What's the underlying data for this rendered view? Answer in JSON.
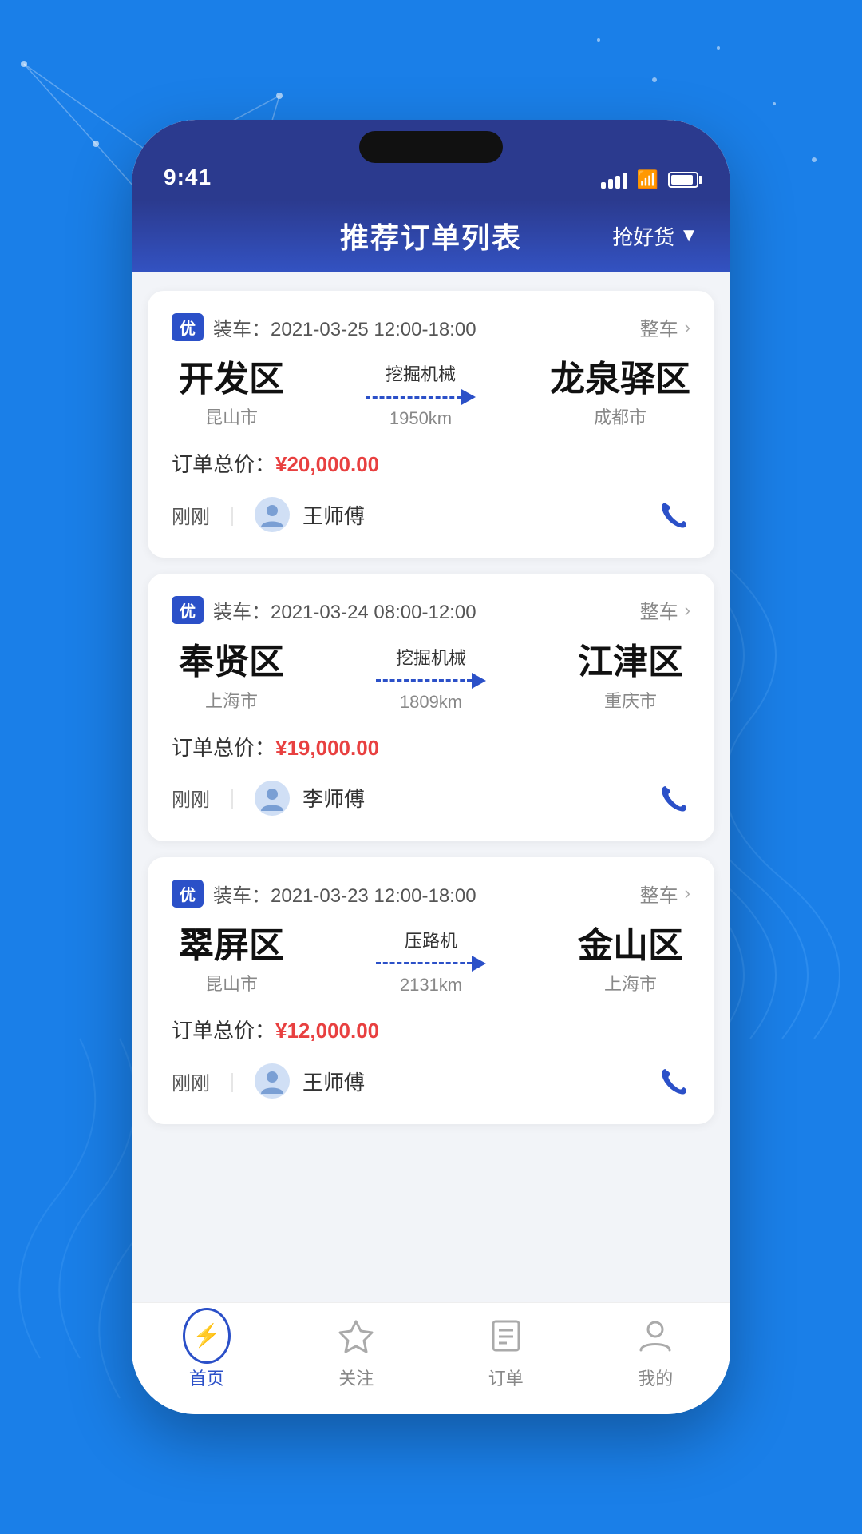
{
  "background": {
    "color": "#1a7fe8"
  },
  "status_bar": {
    "time": "9:41",
    "signal_bars": 4,
    "wifi": true,
    "battery_pct": 90
  },
  "header": {
    "title": "推荐订单列表",
    "action_label": "抢好货"
  },
  "orders": [
    {
      "badge": "优",
      "load_time": "装车：2021-03-25 12:00-18:00",
      "type_label": "整车",
      "from_district": "开发区",
      "from_city": "昆山市",
      "cargo_type": "挖掘机械",
      "distance": "1950km",
      "to_district": "龙泉驿区",
      "to_city": "成都市",
      "price_label": "订单总价：",
      "price_value": "¥20,000.00",
      "time_ago": "刚刚",
      "driver_name": "王师傅"
    },
    {
      "badge": "优",
      "load_time": "装车：2021-03-24 08:00-12:00",
      "type_label": "整车",
      "from_district": "奉贤区",
      "from_city": "上海市",
      "cargo_type": "挖掘机械",
      "distance": "1809km",
      "to_district": "江津区",
      "to_city": "重庆市",
      "price_label": "订单总价：",
      "price_value": "¥19,000.00",
      "time_ago": "刚刚",
      "driver_name": "李师傅"
    },
    {
      "badge": "优",
      "load_time": "装车：2021-03-23 12:00-18:00",
      "type_label": "整车",
      "from_district": "翠屏区",
      "from_city": "昆山市",
      "cargo_type": "压路机",
      "distance": "2131km",
      "to_district": "金山区",
      "to_city": "上海市",
      "price_label": "订单总价：",
      "price_value": "¥12,000.00",
      "time_ago": "刚刚",
      "driver_name": "王师傅"
    }
  ],
  "bottom_nav": [
    {
      "id": "home",
      "label": "首页",
      "active": true
    },
    {
      "id": "follow",
      "label": "关注",
      "active": false
    },
    {
      "id": "orders",
      "label": "订单",
      "active": false
    },
    {
      "id": "mine",
      "label": "我的",
      "active": false
    }
  ]
}
